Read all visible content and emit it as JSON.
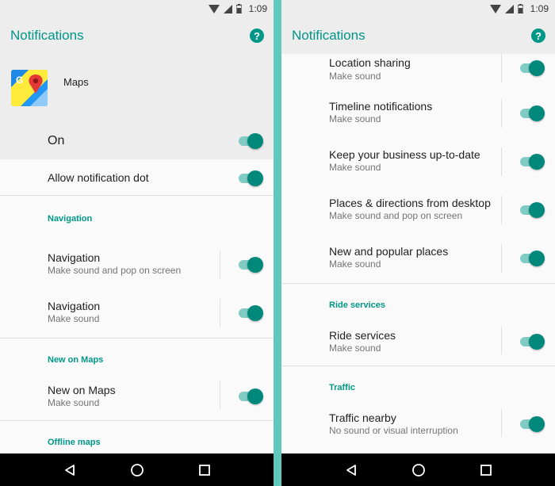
{
  "status": {
    "time": "1:09"
  },
  "left": {
    "title": "Notifications",
    "app_name": "Maps",
    "master_label": "On",
    "allow_dot_label": "Allow notification dot",
    "sections": [
      {
        "header": "Navigation",
        "items": [
          {
            "title": "Navigation",
            "subtitle": "Make sound and pop on screen"
          },
          {
            "title": "Navigation",
            "subtitle": "Make sound"
          }
        ]
      },
      {
        "header": "New on Maps",
        "items": [
          {
            "title": "New on Maps",
            "subtitle": "Make sound"
          }
        ]
      },
      {
        "header": "Offline maps",
        "items": []
      }
    ]
  },
  "right": {
    "title": "Notifications",
    "items_top": [
      {
        "title": "Location sharing",
        "subtitle": "Make sound"
      },
      {
        "title": "Timeline notifications",
        "subtitle": "Make sound"
      },
      {
        "title": "Keep your business up-to-date",
        "subtitle": "Make sound"
      },
      {
        "title": "Places & directions from desktop",
        "subtitle": "Make sound and pop on screen"
      },
      {
        "title": "New and popular places",
        "subtitle": "Make sound"
      }
    ],
    "sections": [
      {
        "header": "Ride services",
        "items": [
          {
            "title": "Ride services",
            "subtitle": "Make sound"
          }
        ]
      },
      {
        "header": "Traffic",
        "items": [
          {
            "title": "Traffic nearby",
            "subtitle": "No sound or visual interruption"
          }
        ]
      }
    ]
  },
  "icons": {
    "help": "help-circle-icon",
    "back": "back-triangle-icon",
    "home": "home-circle-icon",
    "recents": "recents-square-icon"
  },
  "colors": {
    "accent": "#009688",
    "toggle_track": "#80cbc4",
    "toggle_thumb": "#00897b",
    "divider": "#5fc9bd"
  }
}
